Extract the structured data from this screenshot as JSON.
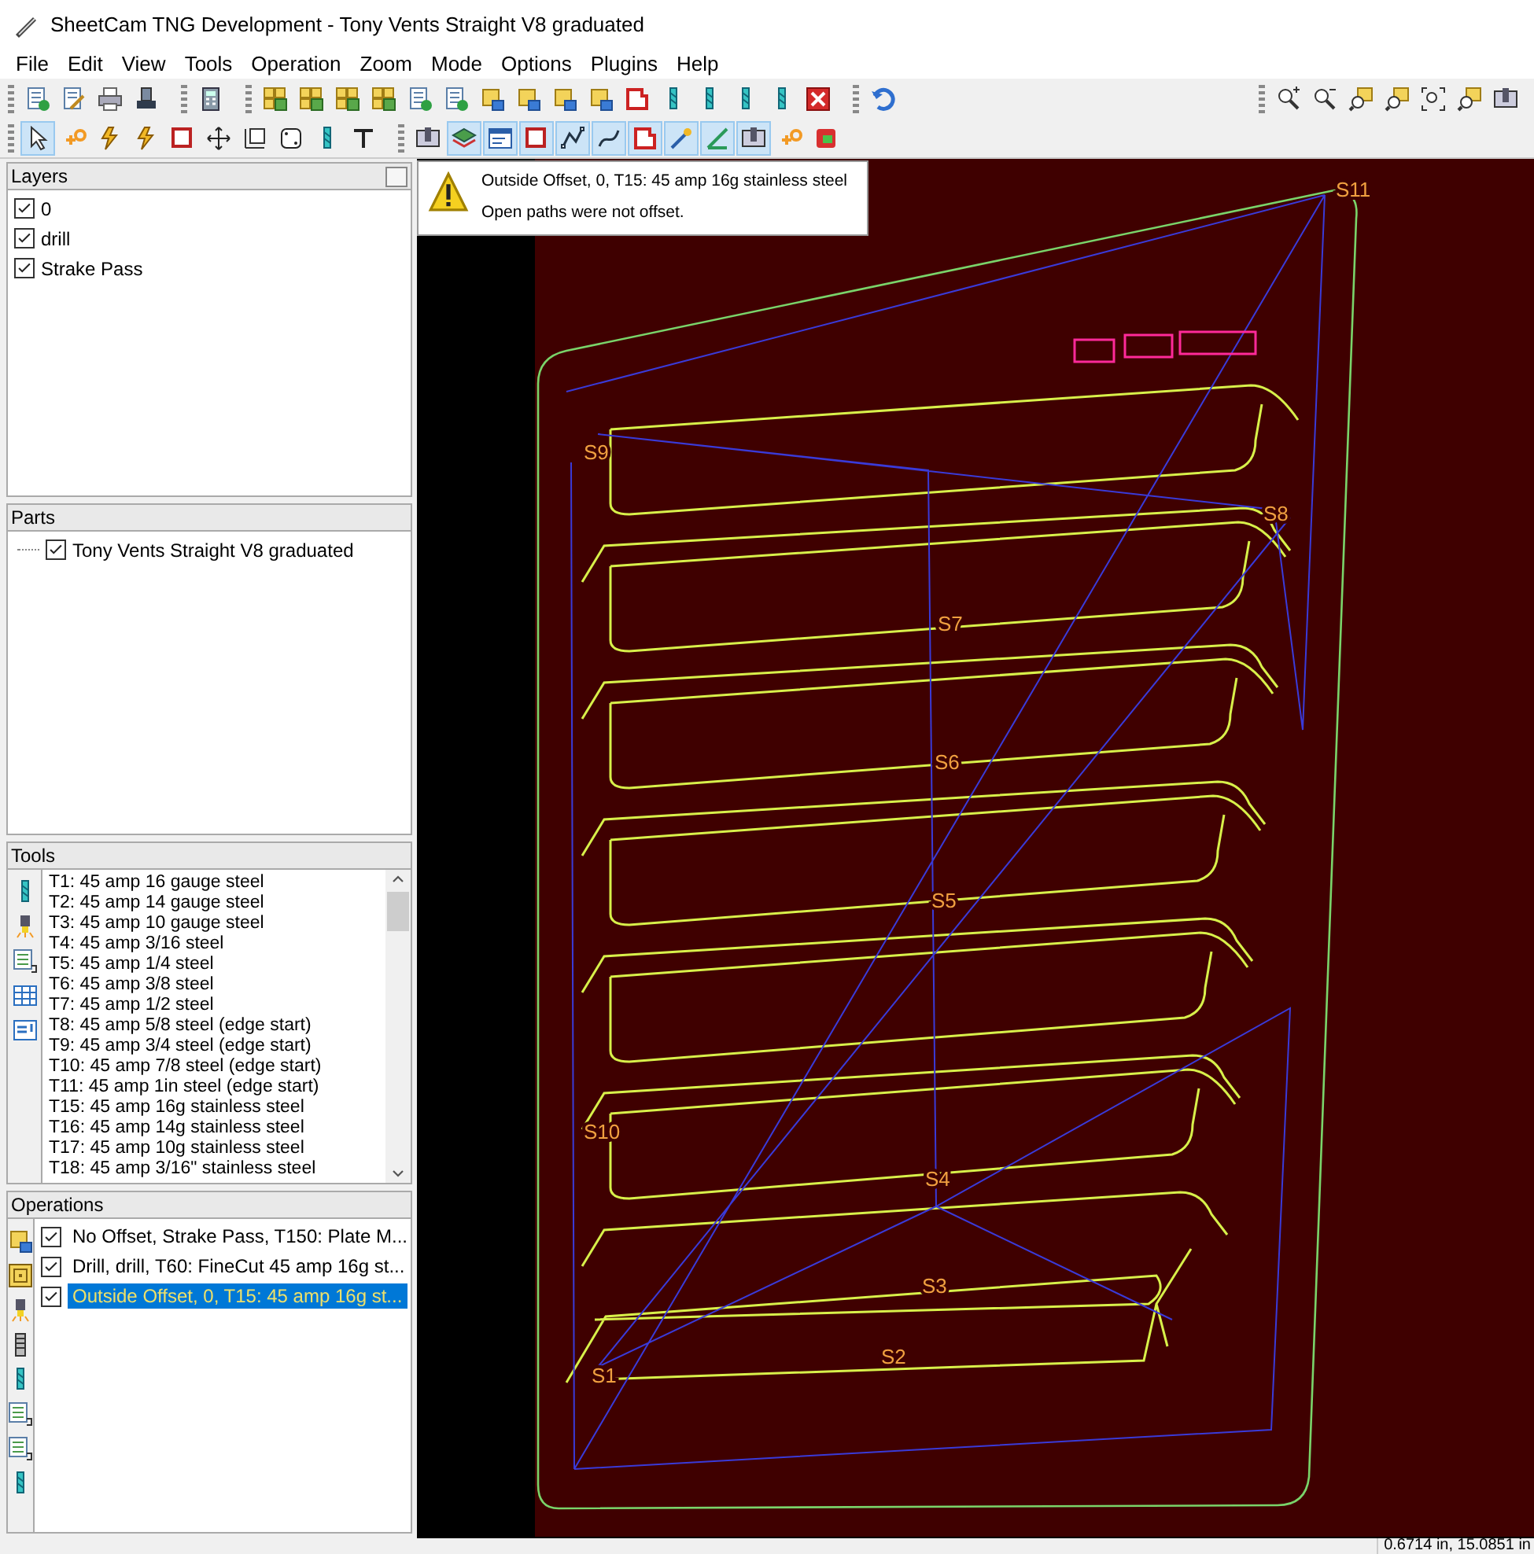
{
  "window": {
    "title": "SheetCam TNG Development - Tony Vents Straight V8 graduated"
  },
  "menu": [
    "File",
    "Edit",
    "View",
    "Tools",
    "Operation",
    "Zoom",
    "Mode",
    "Options",
    "Plugins",
    "Help"
  ],
  "layers": {
    "title": "Layers",
    "items": [
      {
        "label": "0",
        "checked": true
      },
      {
        "label": "drill",
        "checked": true
      },
      {
        "label": "Strake Pass",
        "checked": true
      }
    ]
  },
  "parts": {
    "title": "Parts",
    "items": [
      {
        "label": "Tony Vents Straight V8 graduated",
        "checked": true
      }
    ]
  },
  "tools": {
    "title": "Tools",
    "items": [
      "T1: 45 amp 16 gauge steel",
      "T2: 45 amp 14 gauge steel",
      "T3: 45 amp 10 gauge steel",
      "T4: 45 amp 3/16 steel",
      "T5: 45 amp 1/4 steel",
      "T6: 45 amp 3/8 steel",
      "T7: 45 amp 1/2 steel",
      "T8: 45 amp 5/8 steel (edge start)",
      "T9: 45 amp 3/4 steel (edge start)",
      "T10: 45 amp 7/8 steel (edge start)",
      "T11: 45 amp 1in steel (edge start)",
      "T15: 45 amp 16g stainless steel",
      "T16: 45 amp 14g stainless steel",
      "T17: 45 amp 10g  stainless steel",
      "T18: 45 amp 3/16\" stainless steel"
    ]
  },
  "operations": {
    "title": "Operations",
    "items": [
      {
        "label": "No Offset, Strake Pass, T150: Plate M...",
        "checked": true,
        "selected": false
      },
      {
        "label": "Drill, drill, T60: FineCut 45 amp 16g st...",
        "checked": true,
        "selected": false
      },
      {
        "label": "Outside Offset, 0, T15: 45 amp 16g st...",
        "checked": true,
        "selected": true
      }
    ]
  },
  "warning": {
    "title": "Outside Offset, 0, T15: 45 amp 16g stainless steel",
    "message": "Open paths were not offset."
  },
  "canvas": {
    "start_labels": [
      "S11",
      "S9",
      "S8",
      "S7",
      "S6",
      "S5",
      "S10",
      "S4",
      "S3",
      "S2",
      "S1"
    ]
  },
  "status_bar": {
    "coordinates": "0.6714 in, 15.0851 in"
  }
}
